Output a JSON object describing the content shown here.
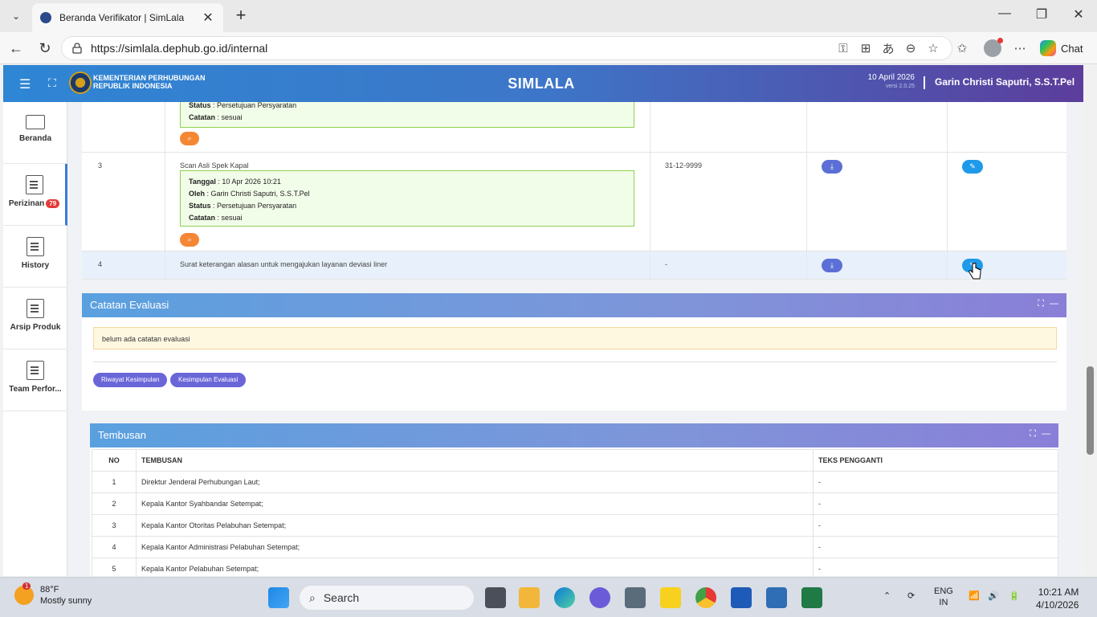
{
  "browser": {
    "tab_title": "Beranda Verifikator | SimLala",
    "url": "https://simlala.dephub.go.id/internal",
    "chat_label": "Chat"
  },
  "header": {
    "org_line1": "KEMENTERIAN PERHUBUNGAN",
    "org_line2": "REPUBLIK INDONESIA",
    "app_title": "SIMLALA",
    "date": "10 April 2026",
    "version": "versi 2.0.25",
    "user": "Garin Christi Saputri, S.S.T.Pel"
  },
  "sidebar": {
    "items": [
      {
        "label": "Beranda"
      },
      {
        "label": "Perizinan",
        "badge": "79"
      },
      {
        "label": "History"
      },
      {
        "label": "Arsip Produk"
      },
      {
        "label": "Team Perfor..."
      }
    ]
  },
  "documents": {
    "partial_row": {
      "status_label": "Status",
      "status_value": "Persetujuan Persyaratan",
      "catatan_label": "Catatan",
      "catatan_value": "sesuai"
    },
    "row3": {
      "no": "3",
      "name": "Scan Asli Spek Kapal",
      "tanggal_label": "Tanggal",
      "tanggal_value": "10 Apr 2026 10:21",
      "oleh_label": "Oleh",
      "oleh_value": "Garin Christi Saputri, S.S.T.Pel",
      "status_label": "Status",
      "status_value": "Persetujuan Persyaratan",
      "catatan_label": "Catatan",
      "catatan_value": "sesuai",
      "expiry": "31-12-9999"
    },
    "row4": {
      "no": "4",
      "name": "Surat keterangan alasan untuk mengajukan layanan deviasi liner",
      "expiry": "-"
    }
  },
  "evaluasi": {
    "title": "Catatan Evaluasi",
    "empty_text": "belum ada catatan evaluasi",
    "btn_riwayat": "Riwayat Kesimpulan",
    "btn_kesimpulan": "Kesimpulan Evaluasi"
  },
  "tembusan": {
    "title": "Tembusan",
    "columns": [
      "NO",
      "TEMBUSAN",
      "TEKS PENGGANTI"
    ],
    "rows": [
      {
        "no": "1",
        "name": "Direktur Jenderal Perhubungan Laut;",
        "teks": "-"
      },
      {
        "no": "2",
        "name": "Kepala Kantor Syahbandar Setempat;",
        "teks": "-"
      },
      {
        "no": "3",
        "name": "Kepala Kantor Otoritas Pelabuhan Setempat;",
        "teks": "-"
      },
      {
        "no": "4",
        "name": "Kepala Kantor Administrasi Pelabuhan Setempat;",
        "teks": "-"
      },
      {
        "no": "5",
        "name": "Kepala Kantor Pelabuhan Setempat;",
        "teks": "-"
      }
    ]
  },
  "taskbar": {
    "weather_badge": "1",
    "temperature": "88°F",
    "condition": "Mostly sunny",
    "search_placeholder": "Search",
    "lang_line1": "ENG",
    "lang_line2": "IN",
    "time": "10:21 AM",
    "date": "4/10/2026"
  }
}
